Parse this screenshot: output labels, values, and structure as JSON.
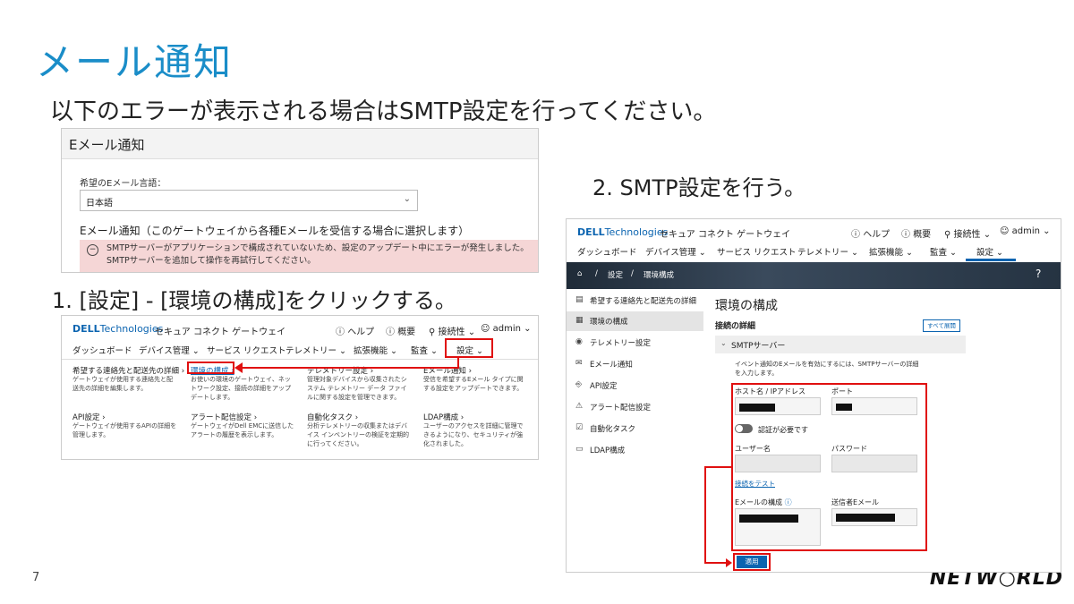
{
  "slide": {
    "title": "メール通知",
    "subtitle": "以下のエラーが表示される場合はSMTP設定を行ってください。",
    "step1": "1.  [設定] - [環境の構成]をクリックする。",
    "step2": "2.  SMTP設定を行う。",
    "page_number": "7",
    "logo": "NETW○RLD"
  },
  "email_shot": {
    "header": "Eメール通知",
    "language_label": "希望のEメール言語：",
    "language_value": "日本語",
    "notification_title": "Eメール通知（このゲートウェイから各種Eメールを受信する場合に選択します）",
    "error_message": "SMTPサーバーがアプリケーションで構成されていないため、設定のアップデート中にエラーが発生しました。SMTPサーバーを追加して操作を再試行してください。"
  },
  "app": {
    "brand": "DELL",
    "brand_tech": "Technologies",
    "product": "セキュア コネクト ゲートウェイ",
    "help": "ヘルプ",
    "overview": "概要",
    "connectivity": "接続性",
    "user": "admin",
    "nav": [
      "ダッシュボード",
      "デバイス管理",
      "サービス リクエスト",
      "テレメトリー",
      "拡張機能",
      "監査",
      "設定"
    ]
  },
  "settings_menu": {
    "items": [
      {
        "title": "希望する連絡先と配送先の詳細",
        "desc": "ゲートウェイが使用する連絡先と配送先の詳細を編集します。"
      },
      {
        "title": "環境の構成",
        "desc": "お使いの環境のゲートウェイ、ネットワーク設定、接続の詳細をアップデートします。"
      },
      {
        "title": "テレメトリー設定",
        "desc": "管理対象デバイスから収集されたシステム テレメトリー データ ファイルに関する設定を管理できます。"
      },
      {
        "title": "Eメール通知",
        "desc": "受信を希望するEメール タイプに関する設定をアップデートできます。"
      },
      {
        "title": "API設定",
        "desc": "ゲートウェイが使用するAPIの詳細を管理します。"
      },
      {
        "title": "アラート配信設定",
        "desc": "ゲートウェイがDell EMCに送信したアラートの履歴を表示します。"
      },
      {
        "title": "自動化タスク",
        "desc": "分析テレメトリーの収集またはデバイス インベントリーの検証を定期的に行ってください。"
      },
      {
        "title": "LDAP構成",
        "desc": "ユーザーのアクセスを詳細に管理できるようになり、セキュリティが強化されました。"
      }
    ]
  },
  "env_config": {
    "breadcrumb": [
      "設定",
      "環境構成"
    ],
    "sidebar": [
      "希望する連絡先と配送先の詳細",
      "環境の構成",
      "テレメトリー設定",
      "Eメール通知",
      "API設定",
      "アラート配信設定",
      "自動化タスク",
      "LDAP構成"
    ],
    "page_title": "環境の構成",
    "section_title": "接続の詳細",
    "expand_all": "すべて展開",
    "smtp_section": "SMTPサーバー",
    "smtp_desc": "イベント通知のEメールを有効にするには、SMTPサーバーの詳細を入力します。",
    "host_label": "ホスト名 / IPアドレス",
    "port_label": "ポート",
    "auth_label": "認証が必要です",
    "username_label": "ユーザー名",
    "password_label": "パスワード",
    "test_link": "接続をテスト",
    "email_config_label": "Eメールの構成",
    "sender_label": "送信者Eメール",
    "apply_button": "適用"
  },
  "colors": {
    "title_blue": "#1a8dc8",
    "dell_blue": "#0b64b0",
    "highlight_red": "#e01010",
    "error_bg": "#f5d6d6"
  }
}
